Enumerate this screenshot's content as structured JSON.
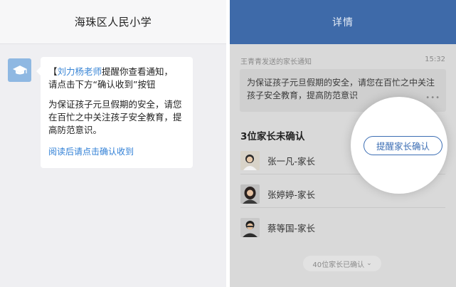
{
  "left": {
    "header_title": "海珠区人民小学",
    "bubble": {
      "bracket_open": "【",
      "teacher_name": "刘力杨老师",
      "line1_rest": "提醒你查看通知，",
      "line2": "请点击下方“确认收到”按钮",
      "body": "为保证孩子元旦假期的安全，请您在百忙之中关注孩子安全教育，提高防范意识。",
      "link": "阅读后请点击确认收到"
    },
    "avatar_icon": "graduation-cap-icon"
  },
  "right": {
    "header_title": "详情",
    "msg_sender": "王青青发送的家长通知",
    "msg_time": "15:32",
    "msg_text": "为保证孩子元旦假期的安全，请您在百忙之中关注孩子安全教育，提高防范意识",
    "unconfirmed_title": "3位家长未确认",
    "parents": [
      {
        "name": "张一凡-家长"
      },
      {
        "name": "张婷婷-家长"
      },
      {
        "name": "蔡等国-家长"
      }
    ],
    "confirmed_count": "40位家长已确认",
    "remind_button": "提醒家长确认",
    "colors": {
      "header": "#3e6aa9",
      "accent": "#3c6eb4"
    }
  }
}
